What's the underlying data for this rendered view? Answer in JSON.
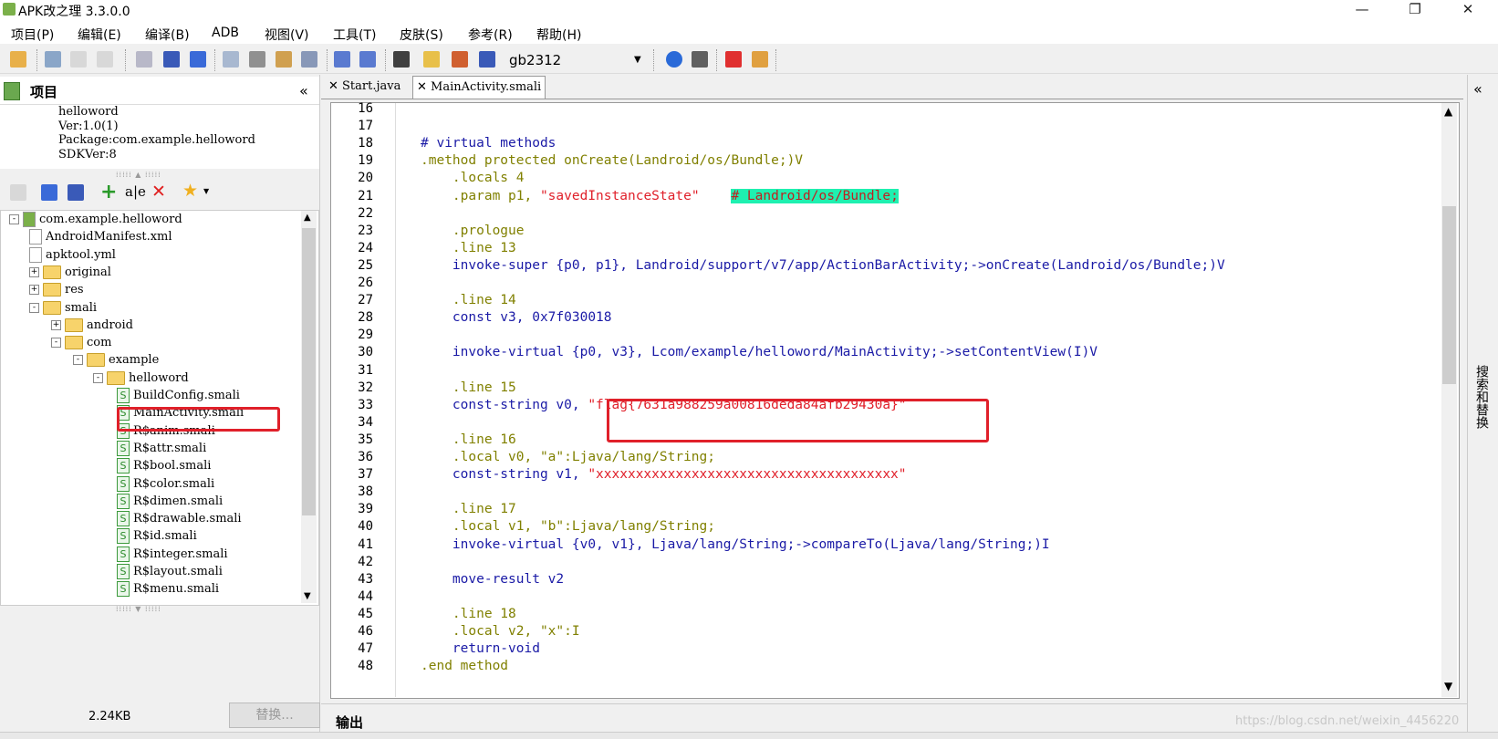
{
  "window": {
    "title": "APK改之理 3.3.0.0",
    "minimize": "—",
    "maximize": "❐",
    "close": "✕"
  },
  "menu": [
    "项目(P)",
    "编辑(E)",
    "编译(B)",
    "ADB",
    "视图(V)",
    "工具(T)",
    "皮肤(S)",
    "参考(R)",
    "帮助(H)"
  ],
  "toolbar": {
    "encoding": "gb2312"
  },
  "project": {
    "title": "项目",
    "collapse": "«",
    "info": [
      "helloword",
      "Ver:1.0(1)",
      "Package:com.example.helloword",
      "SDKVer:8"
    ]
  },
  "tree": [
    {
      "label": "com.example.helloword",
      "type": "root"
    },
    {
      "label": "AndroidManifest.xml",
      "type": "file"
    },
    {
      "label": "apktool.yml",
      "type": "file"
    },
    {
      "label": "original",
      "type": "folder",
      "state": "+"
    },
    {
      "label": "res",
      "type": "folder",
      "state": "+"
    },
    {
      "label": "smali",
      "type": "folder",
      "state": "-"
    },
    {
      "label": "android",
      "type": "folder",
      "state": "+"
    },
    {
      "label": "com",
      "type": "folder",
      "state": "-"
    },
    {
      "label": "example",
      "type": "folder",
      "state": "-"
    },
    {
      "label": "helloword",
      "type": "folder",
      "state": "-"
    },
    {
      "label": "BuildConfig.smali",
      "type": "smali"
    },
    {
      "label": "MainActivity.smali",
      "type": "smali"
    },
    {
      "label": "R$anim.smali",
      "type": "smali"
    },
    {
      "label": "R$attr.smali",
      "type": "smali"
    },
    {
      "label": "R$bool.smali",
      "type": "smali"
    },
    {
      "label": "R$color.smali",
      "type": "smali"
    },
    {
      "label": "R$dimen.smali",
      "type": "smali"
    },
    {
      "label": "R$drawable.smali",
      "type": "smali"
    },
    {
      "label": "R$id.smali",
      "type": "smali"
    },
    {
      "label": "R$integer.smali",
      "type": "smali"
    },
    {
      "label": "R$layout.smali",
      "type": "smali"
    },
    {
      "label": "R$menu.smali",
      "type": "smali"
    }
  ],
  "status": {
    "size": "2.24KB",
    "replace": "替换..."
  },
  "tabs": [
    "Start.java",
    "MainActivity.smali"
  ],
  "editor": {
    "line_numbers": [
      "16",
      "17",
      "18",
      "19",
      "20",
      "21",
      "22",
      "23",
      "24",
      "25",
      "26",
      "27",
      "28",
      "29",
      "30",
      "31",
      "32",
      "33",
      "34",
      "35",
      "36",
      "37",
      "38",
      "39",
      "40",
      "41",
      "42",
      "43",
      "44",
      "45",
      "46",
      "47",
      "48"
    ],
    "lines": [
      "",
      "",
      "# virtual methods",
      ".method protected onCreate(Landroid/os/Bundle;)V",
      "    .locals 4",
      "    .param p1, \"savedInstanceState\"    # Landroid/os/Bundle;",
      "",
      "    .prologue",
      "    .line 13",
      "    invoke-super {p0, p1}, Landroid/support/v7/app/ActionBarActivity;->onCreate(Landroid/os/Bundle;)V",
      "",
      "    .line 14",
      "    const v3, 0x7f030018",
      "",
      "    invoke-virtual {p0, v3}, Lcom/example/helloword/MainActivity;->setContentView(I)V",
      "",
      "    .line 15",
      "    const-string v0, \"flag{7631a988259a00816deda84afb29430a}\"",
      "",
      "    .line 16",
      "    .local v0, \"a\":Ljava/lang/String;",
      "    const-string v1, \"xxxxxxxxxxxxxxxxxxxxxxxxxxxxxxxxxxxxxx\"",
      "",
      "    .line 17",
      "    .local v1, \"b\":Ljava/lang/String;",
      "    invoke-virtual {v0, v1}, Ljava/lang/String;->compareTo(Ljava/lang/String;)I",
      "",
      "    move-result v2",
      "",
      "    .line 18",
      "    .local v2, \"x\":I",
      "    return-void",
      ".end method"
    ]
  },
  "right_panel": {
    "collapse": "«",
    "label": "搜索和替换"
  },
  "output": {
    "label": "输出",
    "watermark": "https://blog.csdn.net/weixin_4456220"
  }
}
